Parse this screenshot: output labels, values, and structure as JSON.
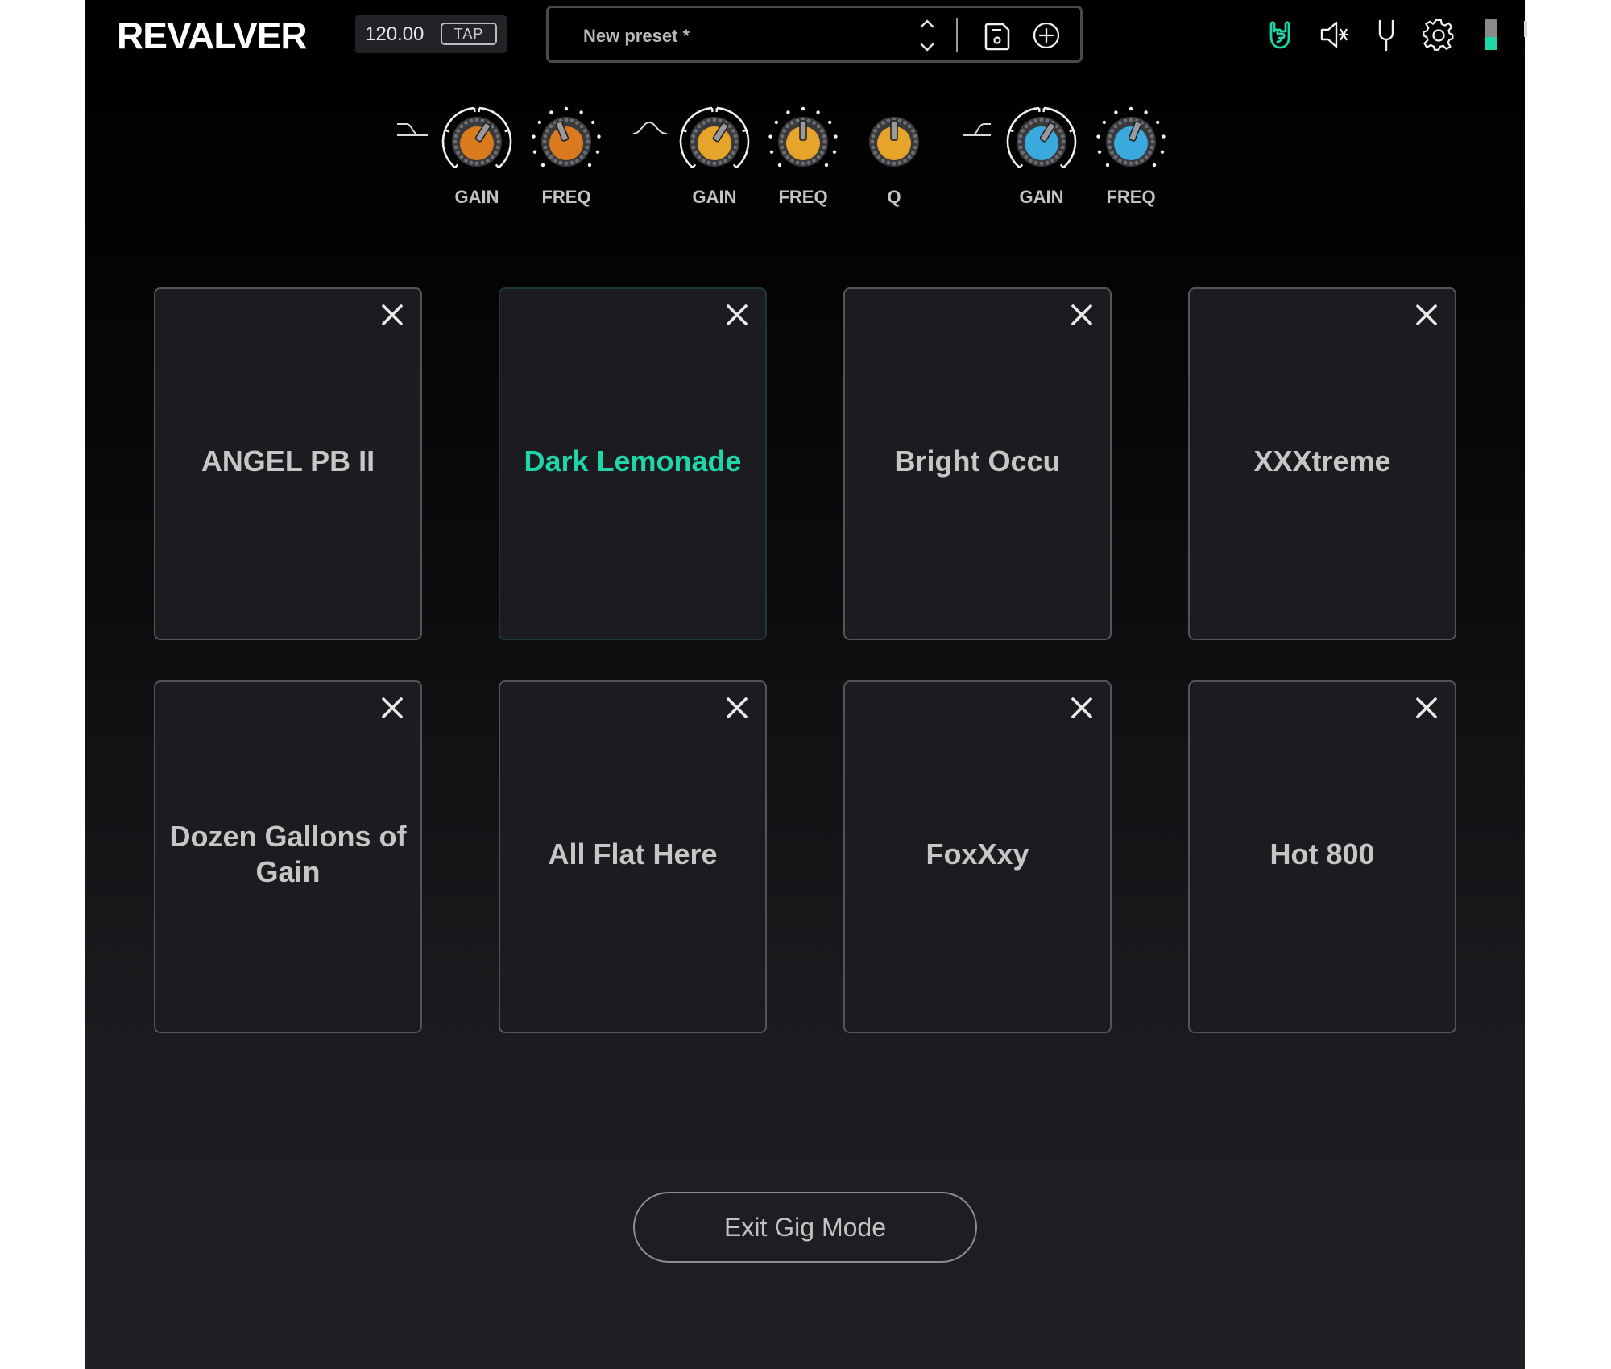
{
  "header": {
    "logo_text": "REVALVER",
    "tempo": "120.00",
    "tap_label": "TAP",
    "preset_name": "New preset *",
    "icons": {
      "preset_prev": "chevron-up-icon",
      "preset_next": "chevron-down-icon",
      "save": "save-icon",
      "add": "add-circle-icon",
      "gig_mode": "rock-hand-icon",
      "mute": "speaker-mute-icon",
      "tuner": "tuning-fork-icon",
      "settings": "gear-icon"
    },
    "output_meter_level": 0.4,
    "accent_color": "#1fd6a8"
  },
  "eq": {
    "bands": [
      {
        "type": "low-shelf",
        "icon": "low-shelf-icon",
        "color": "#d97a1f",
        "knobs": [
          {
            "label": "GAIN",
            "value": 0.62,
            "style": "arc"
          },
          {
            "label": "FREQ",
            "value": 0.42,
            "style": "dots"
          }
        ]
      },
      {
        "type": "peak",
        "icon": "bell-curve-icon",
        "color": "#e6a52a",
        "knobs": [
          {
            "label": "GAIN",
            "value": 0.62,
            "style": "arc"
          },
          {
            "label": "FREQ",
            "value": 0.5,
            "style": "dots"
          },
          {
            "label": "Q",
            "value": 0.5,
            "style": "plain"
          }
        ]
      },
      {
        "type": "high-shelf",
        "icon": "high-shelf-icon",
        "color": "#3aa9dd",
        "knobs": [
          {
            "label": "GAIN",
            "value": 0.62,
            "style": "arc"
          },
          {
            "label": "FREQ",
            "value": 0.58,
            "style": "dots"
          }
        ]
      }
    ]
  },
  "presets": [
    {
      "name": "ANGEL PB II",
      "active": false
    },
    {
      "name": "Dark Lemonade",
      "active": true
    },
    {
      "name": "Bright Occu",
      "active": false
    },
    {
      "name": "XXXtreme",
      "active": false
    },
    {
      "name": "Dozen Gallons of Gain",
      "active": false
    },
    {
      "name": "All Flat Here",
      "active": false
    },
    {
      "name": "FoxXxy",
      "active": false
    },
    {
      "name": "Hot 800",
      "active": false
    }
  ],
  "exit_button_label": "Exit Gig Mode"
}
